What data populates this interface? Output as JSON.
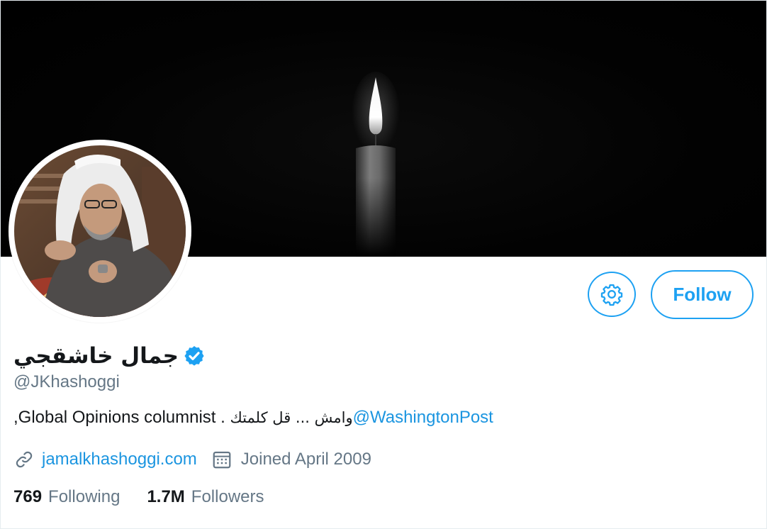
{
  "profile": {
    "display_name": "جمال خاشقجي",
    "handle": "@JKhashoggi",
    "verified": true,
    "bio": {
      "text_start": "Global Opinions columnist . ",
      "arabic": "وامش ... قل كلمتك",
      "mention": "@WashingtonPost",
      "text_end": ","
    },
    "website": "jamalkhashoggi.com",
    "joined": "Joined April 2009",
    "stats": {
      "following_count": "769",
      "following_label": "Following",
      "followers_count": "1.7M",
      "followers_label": "Followers"
    }
  },
  "actions": {
    "follow_label": "Follow",
    "settings_icon": "gear-icon"
  },
  "icons": {
    "link": "link-icon",
    "calendar": "calendar-icon",
    "verified": "verified-badge-icon"
  },
  "colors": {
    "accent": "#1da1f2",
    "link": "#1b95e0",
    "text_primary": "#14171a",
    "text_secondary": "#657786",
    "banner": "#000000"
  }
}
